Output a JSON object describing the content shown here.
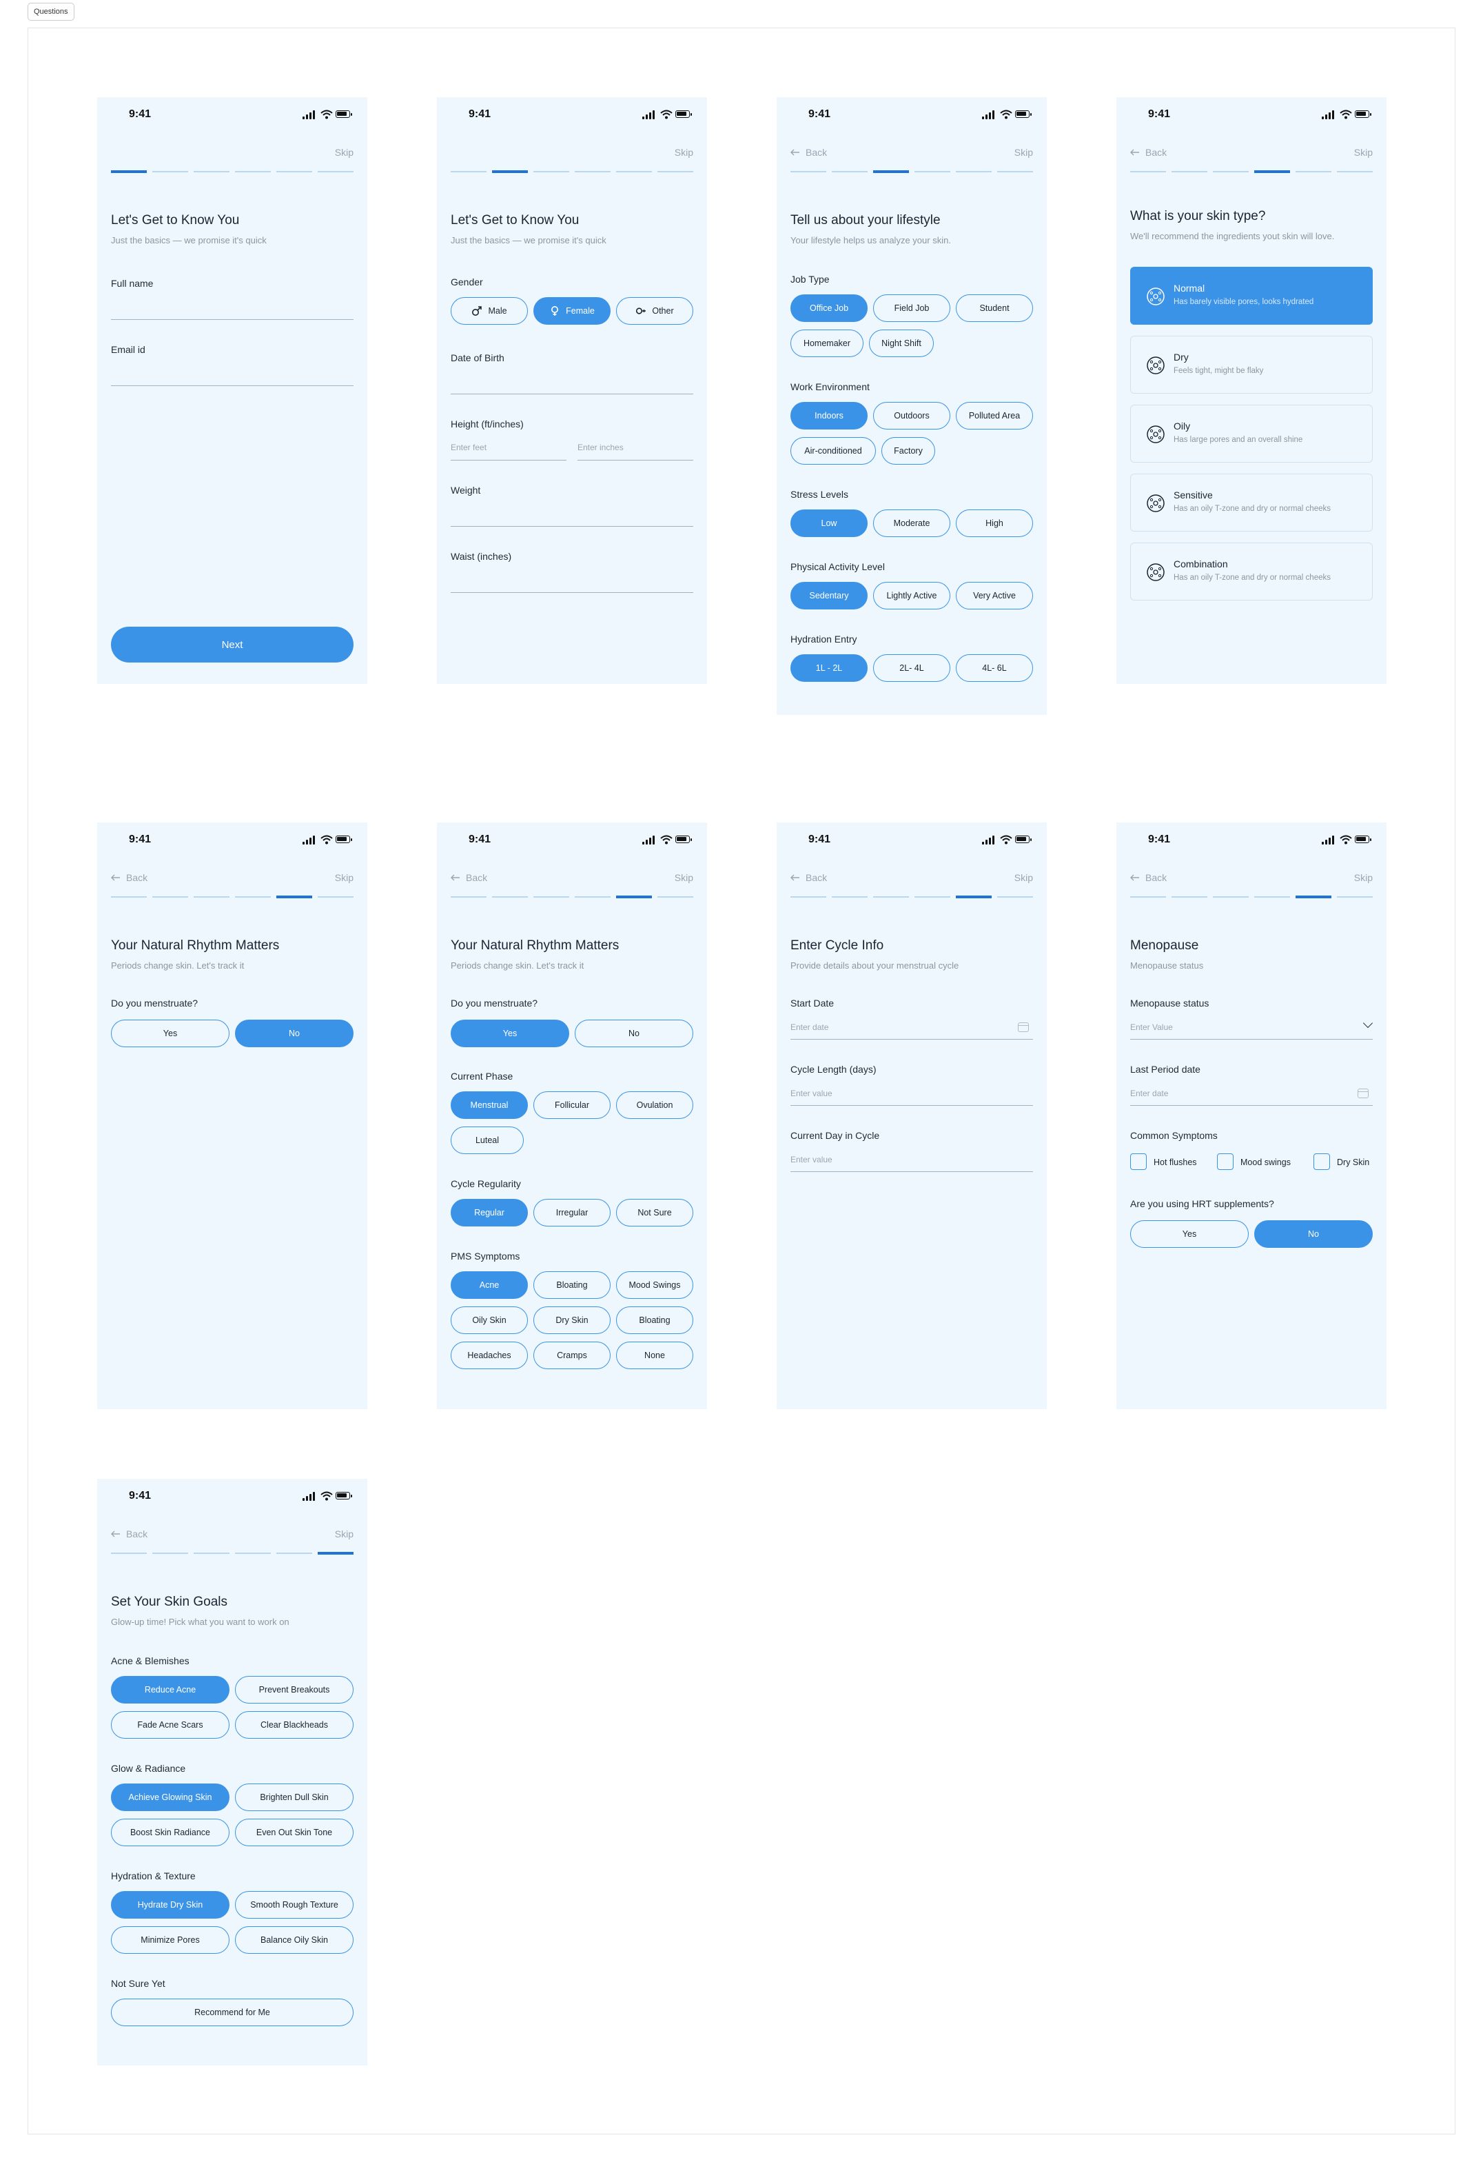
{
  "frame_label": "Questions",
  "status_time": "9:41",
  "back_label": "Back",
  "skip_label": "Skip",
  "screens": {
    "s1": {
      "title": "Let's Get to Know You",
      "subtitle": "Just the basics — we promise it's quick",
      "full_name_label": "Full name",
      "email_label": "Email id",
      "next_label": "Next"
    },
    "s2": {
      "title": "Let's Get to Know You",
      "subtitle": "Just the basics — we promise it's quick",
      "gender_label": "Gender",
      "gender_options": [
        "Male",
        "Female",
        "Other"
      ],
      "gender_selected": "Female",
      "dob_label": "Date of Birth",
      "height_label": "Height (ft/inches)",
      "feet_placeholder": "Enter feet",
      "inches_placeholder": "Enter inches",
      "weight_label": "Weight",
      "waist_label": "Waist (inches)"
    },
    "s3": {
      "title": "Tell us about your lifestyle",
      "subtitle": "Your lifestyle helps us analyze your skin.",
      "job_label": "Job Type",
      "job_options": [
        "Office Job",
        "Field Job",
        "Student",
        "Homemaker",
        "Night Shift"
      ],
      "work_label": "Work Environment",
      "work_options": [
        "Indoors",
        "Outdoors",
        "Polluted Area",
        "Air-conditioned",
        "Factory"
      ],
      "stress_label": "Stress Levels",
      "stress_options": [
        "Low",
        "Moderate",
        "High"
      ],
      "activity_label": "Physical Activity Level",
      "activity_options": [
        "Sedentary",
        "Lightly Active",
        "Very Active"
      ],
      "hydration_label": "Hydration Entry",
      "hydration_options": [
        "1L - 2L",
        "2L- 4L",
        "4L- 6L"
      ]
    },
    "s4": {
      "title": "What is your skin type?",
      "subtitle": "We'll recommend the ingredients yout skin will love.",
      "options": [
        {
          "name": "Normal",
          "desc": "Has barely visible pores, looks hydrated"
        },
        {
          "name": "Dry",
          "desc": "Feels tight, might be flaky"
        },
        {
          "name": "Oily",
          "desc": "Has large pores and an overall shine"
        },
        {
          "name": "Sensitive",
          "desc": "Has an oily T-zone and dry or normal cheeks"
        },
        {
          "name": "Combination",
          "desc": "Has an oily T-zone and dry or normal cheeks"
        }
      ],
      "selected": "Normal"
    },
    "s5": {
      "title": "Your Natural Rhythm Matters",
      "subtitle": "Periods change skin. Let's track it",
      "question": "Do you menstruate?",
      "options": [
        "Yes",
        "No"
      ],
      "selected": "No"
    },
    "s6": {
      "title": "Your Natural Rhythm Matters",
      "subtitle": "Periods change skin. Let's track it",
      "question": "Do you menstruate?",
      "options": [
        "Yes",
        "No"
      ],
      "phase_label": "Current Phase",
      "phase_options": [
        "Menstrual",
        "Follicular",
        "Ovulation",
        "Luteal"
      ],
      "regularity_label": "Cycle Regularity",
      "regularity_options": [
        "Regular",
        "Irregular",
        "Not Sure"
      ],
      "pms_label": "PMS Symptoms",
      "pms_options": [
        "Acne",
        "Bloating",
        "Mood Swings",
        "Oily Skin",
        "Dry Skin",
        "Bloating",
        "Headaches",
        "Cramps",
        "None"
      ]
    },
    "s7": {
      "title": "Enter Cycle Info",
      "subtitle": "Provide details about your menstrual cycle",
      "start_label": "Start Date",
      "start_placeholder": "Enter date",
      "length_label": "Cycle Length (days)",
      "length_placeholder": "Enter value",
      "day_label": "Current Day in Cycle",
      "day_placeholder": "Enter value"
    },
    "s8": {
      "title": "Menopause",
      "subtitle": "Menopause status",
      "status_label": "Menopause status",
      "status_placeholder": "Enter Value",
      "last_label": "Last Period date",
      "last_placeholder": "Enter date",
      "symptoms_label": "Common Symptoms",
      "symptoms": [
        "Hot flushes",
        "Mood swings",
        "Dry Skin"
      ],
      "hrt_label": "Are you using HRT supplements?",
      "hrt_options": [
        "Yes",
        "No"
      ],
      "hrt_selected": "No"
    },
    "s9": {
      "title": "Set Your Skin Goals",
      "subtitle": "Glow-up time! Pick what you want to work on",
      "acne_label": "Acne & Blemishes",
      "acne_options": [
        "Reduce Acne",
        "Prevent Breakouts",
        "Fade Acne Scars",
        "Clear Blackheads"
      ],
      "glow_label": "Glow & Radiance",
      "glow_options": [
        "Achieve Glowing Skin",
        "Brighten Dull Skin",
        "Boost Skin Radiance",
        "Even Out Skin Tone"
      ],
      "hydration_label": "Hydration & Texture",
      "hydration_options": [
        "Hydrate Dry Skin",
        "Smooth Rough Texture",
        "Minimize Pores",
        "Balance Oily Skin"
      ],
      "unsure_label": "Not Sure Yet",
      "recommend_label": "Recommend for Me"
    }
  },
  "colors": {
    "screen_bg": "#eef7fe",
    "accent": "#3b93e8",
    "progress_active": "#1f73d6",
    "progress_inactive": "#b9d8ef"
  }
}
